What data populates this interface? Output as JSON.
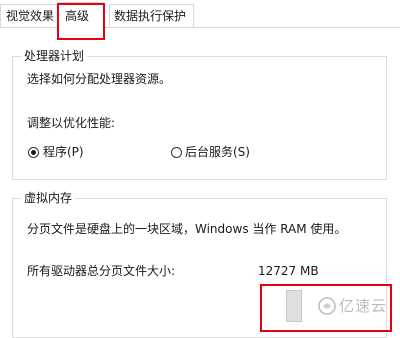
{
  "tabs": [
    {
      "label": "视觉效果"
    },
    {
      "label": "高级"
    },
    {
      "label": "数据执行保护"
    }
  ],
  "processor_scheduling": {
    "title": "处理器计划",
    "description": "选择如何分配处理器资源。",
    "adjust_label": "调整以优化性能:",
    "options": [
      {
        "label": "程序(P)",
        "selected": true
      },
      {
        "label": "后台服务(S)",
        "selected": false
      }
    ]
  },
  "virtual_memory": {
    "title": "虚拟内存",
    "description": "分页文件是硬盘上的一块区域，Windows 当作 RAM 使用。",
    "total_label": "所有驱动器总分页文件大小:",
    "total_value": "12727 MB"
  },
  "watermark": {
    "text": "亿速云",
    "icon": "cloud-logo-icon"
  },
  "colors": {
    "highlight": "#e60012",
    "border": "#dcdcdc",
    "text": "#1a1a1a"
  }
}
